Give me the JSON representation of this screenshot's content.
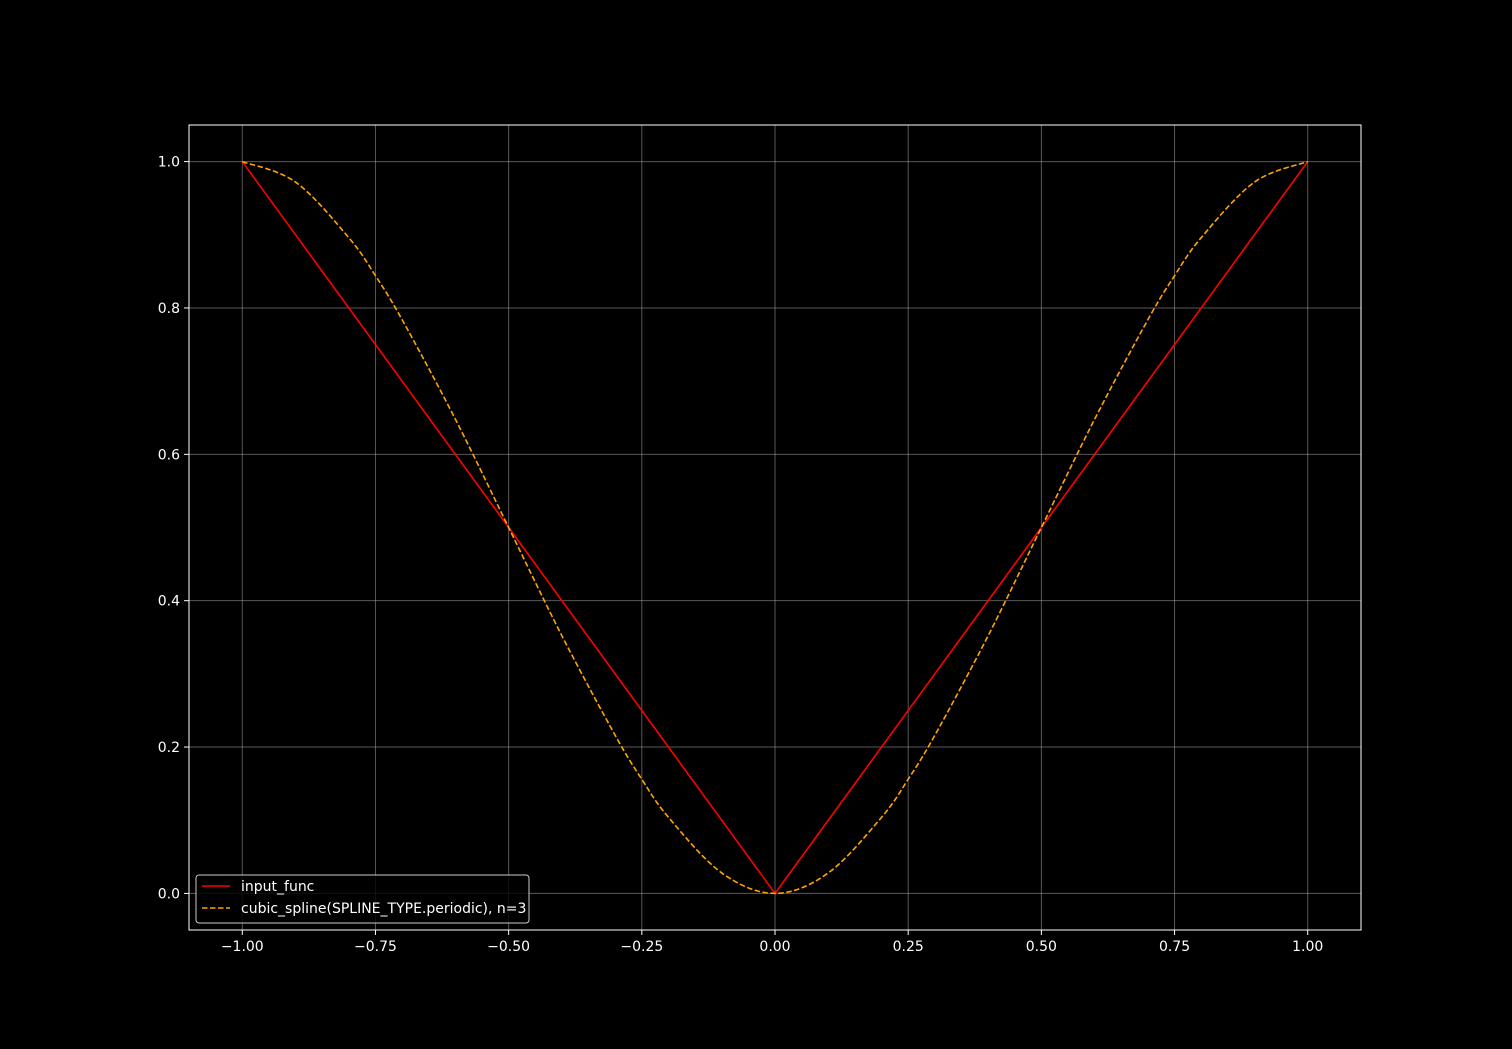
{
  "chart_data": {
    "type": "line",
    "title": "",
    "xlabel": "",
    "ylabel": "",
    "xlim": [
      -1.1,
      1.1
    ],
    "ylim": [
      -0.05,
      1.05
    ],
    "x_ticks": [
      -1.0,
      -0.75,
      -0.5,
      -0.25,
      0.0,
      0.25,
      0.5,
      0.75,
      1.0
    ],
    "x_tick_labels": [
      "−1.00",
      "−0.75",
      "−0.50",
      "−0.25",
      "0.00",
      "0.25",
      "0.50",
      "0.75",
      "1.00"
    ],
    "y_ticks": [
      0.0,
      0.2,
      0.4,
      0.6,
      0.8,
      1.0
    ],
    "y_tick_labels": [
      "0.0",
      "0.2",
      "0.4",
      "0.6",
      "0.8",
      "1.0"
    ],
    "grid": true,
    "legend_position": "lower-left",
    "series": [
      {
        "name": "input_func",
        "color": "#ff0000",
        "style": "solid",
        "x": [
          -1.0,
          0.0,
          1.0
        ],
        "y": [
          1.0,
          0.0,
          1.0
        ]
      },
      {
        "name": "cubic_spline(SPLINE_TYPE.periodic), n=3",
        "color": "#ffa500",
        "style": "dashed",
        "x": [
          -1.0,
          -0.9,
          -0.8,
          -0.75,
          -0.7,
          -0.6,
          -0.5,
          -0.4,
          -0.3,
          -0.25,
          -0.2,
          -0.1,
          0.0,
          0.1,
          0.2,
          0.25,
          0.3,
          0.4,
          0.5,
          0.6,
          0.7,
          0.75,
          0.8,
          0.9,
          1.0
        ],
        "y": [
          1.0,
          0.972,
          0.896,
          0.844,
          0.784,
          0.648,
          0.5,
          0.352,
          0.216,
          0.156,
          0.104,
          0.028,
          0.0,
          0.028,
          0.104,
          0.156,
          0.216,
          0.352,
          0.5,
          0.648,
          0.784,
          0.844,
          0.896,
          0.972,
          1.0
        ]
      }
    ]
  }
}
